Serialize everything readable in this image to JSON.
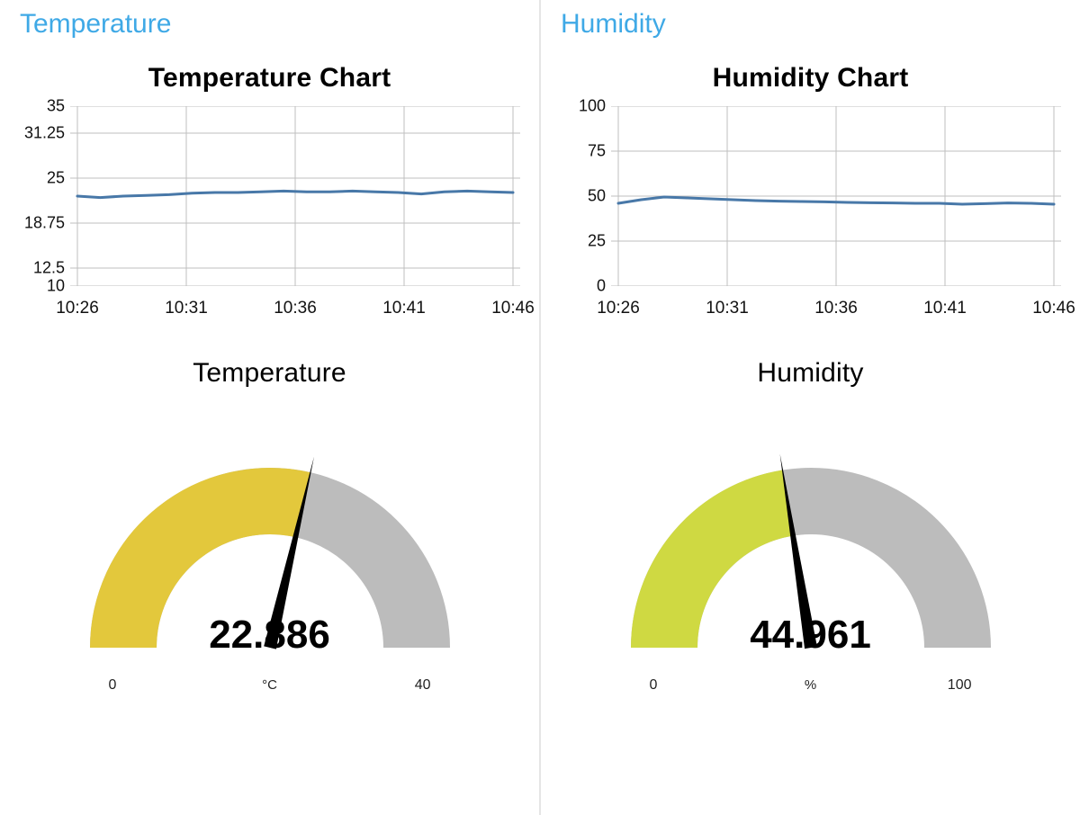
{
  "panels": {
    "temperature": {
      "header": "Temperature",
      "chart_title": "Temperature Chart",
      "gauge_title": "Temperature",
      "gauge_value": "22.886",
      "gauge_unit": "°C",
      "gauge_min_label": "0",
      "gauge_max_label": "40",
      "gauge_min": 0,
      "gauge_max": 40,
      "gauge_current": 22.886,
      "gauge_fill_color": "#e3c83c"
    },
    "humidity": {
      "header": "Humidity",
      "chart_title": "Humidity Chart",
      "gauge_title": "Humidity",
      "gauge_value": "44.961",
      "gauge_unit": "%",
      "gauge_min_label": "0",
      "gauge_max_label": "100",
      "gauge_min": 0,
      "gauge_max": 100,
      "gauge_current": 44.961,
      "gauge_fill_color": "#cfd942"
    }
  },
  "colors": {
    "accent": "#3fa9e6",
    "line": "#4878a8",
    "grid": "#bfbfbf",
    "gauge_track": "#bcbcbc"
  },
  "chart_data": [
    {
      "type": "line",
      "title": "Temperature Chart",
      "xlabel": "",
      "ylabel": "",
      "x_ticks": [
        "10:26",
        "10:31",
        "10:36",
        "10:41",
        "10:46"
      ],
      "y_ticks": [
        10,
        12.5,
        18.75,
        25,
        31.25,
        35
      ],
      "ylim": [
        10,
        35
      ],
      "series": [
        {
          "name": "Temperature",
          "values": [
            22.5,
            22.3,
            22.5,
            22.6,
            22.7,
            22.9,
            23.0,
            23.0,
            23.1,
            23.2,
            23.1,
            23.1,
            23.2,
            23.1,
            23.0,
            22.8,
            23.1,
            23.2,
            23.1,
            23.0
          ]
        }
      ]
    },
    {
      "type": "line",
      "title": "Humidity Chart",
      "xlabel": "",
      "ylabel": "",
      "x_ticks": [
        "10:26",
        "10:31",
        "10:36",
        "10:41",
        "10:46"
      ],
      "y_ticks": [
        0,
        25,
        50,
        75,
        100
      ],
      "ylim": [
        0,
        100
      ],
      "series": [
        {
          "name": "Humidity",
          "values": [
            46,
            48,
            49.5,
            49,
            48.5,
            48,
            47.5,
            47.2,
            47,
            46.8,
            46.5,
            46.3,
            46.2,
            46,
            46,
            45.5,
            45.8,
            46.2,
            46,
            45.5
          ]
        }
      ]
    }
  ]
}
